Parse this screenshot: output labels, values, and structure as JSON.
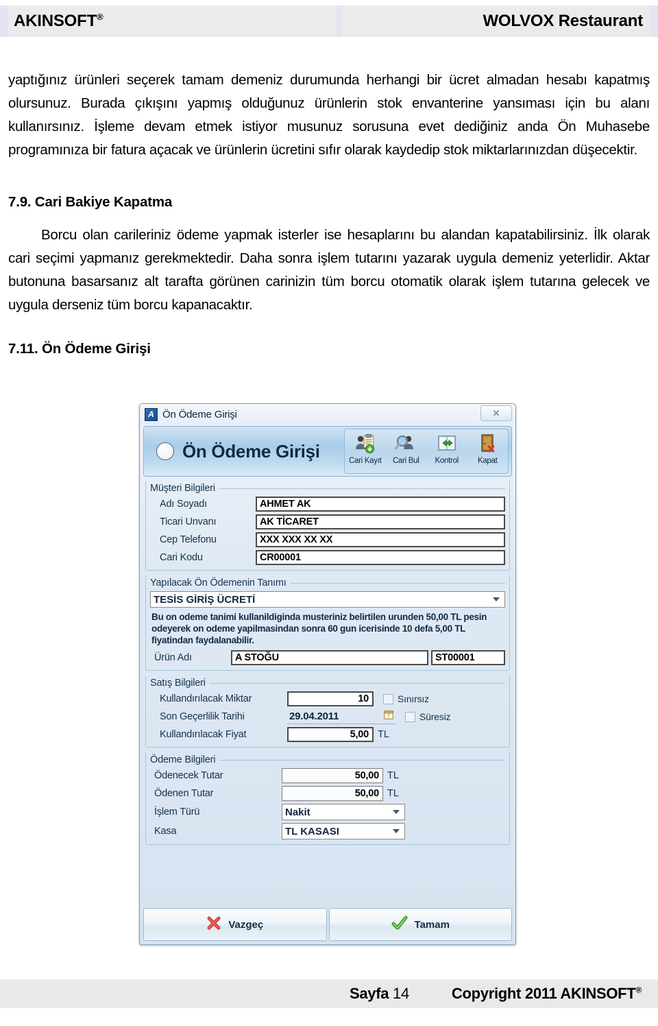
{
  "header": {
    "brand": "AKINSOFT",
    "brand_mark": "®",
    "product": "WOLVOX Restaurant"
  },
  "content": {
    "paragraph_1": "yaptığınız ürünleri seçerek tamam demeniz durumunda herhangi bir ücret almadan hesabı kapatmış olursunuz. Burada çıkışını yapmış olduğunuz ürünlerin stok envanterine yansıması için bu alanı kullanırsınız. İşleme devam etmek istiyor musunuz sorusuna evet dediğiniz anda Ön Muhasebe programınıza bir fatura açacak ve ürünlerin ücretini sıfır olarak kaydedip stok miktarlarınızdan düşecektir.",
    "section_79_title": "7.9. Cari Bakiye Kapatma",
    "paragraph_2": "Borcu olan carileriniz ödeme yapmak isterler ise hesaplarını bu alandan kapatabilirsiniz. İlk olarak cari seçimi yapmanız gerekmektedir. Daha sonra işlem tutarını yazarak uygula demeniz yeterlidir. Aktar butonuna basarsanız alt tarafta görünen carinizin tüm borcu otomatik olarak işlem tutarına gelecek ve uygula derseniz tüm borcu kapanacaktır.",
    "section_711_title": "7.11. Ön Ödeme Girişi"
  },
  "dialog": {
    "window_title": "Ön Ödeme Girişi",
    "app_icon_letter": "A",
    "close_label": "✕",
    "banner_title": "Ön Ödeme Girişi",
    "toolbar": [
      {
        "label": "Cari Kayıt",
        "icon": "user-record-add-icon"
      },
      {
        "label": "Cari Bul",
        "icon": "user-search-icon"
      },
      {
        "label": "Kontrol",
        "icon": "sync-arrows-icon"
      },
      {
        "label": "Kapat",
        "icon": "door-close-icon"
      }
    ],
    "customer_group": {
      "legend": "Müşteri Bilgileri",
      "fields": [
        {
          "label": "Adı Soyadı",
          "value": "AHMET AK"
        },
        {
          "label": "Ticari Unvanı",
          "value": "AK TİCARET"
        },
        {
          "label": "Cep Telefonu",
          "value": "XXX XXX XX XX"
        },
        {
          "label": "Cari Kodu",
          "value": "CR00001"
        }
      ]
    },
    "definition_group": {
      "legend": "Yapılacak Ön Ödemenin Tanımı",
      "combo_value": "TESİS GİRİŞ ÜCRETİ",
      "description": "Bu on odeme tanimi kullanildiginda musteriniz belirtilen urunden 50,00 TL pesin odeyerek on odeme yapilmasindan sonra 60 gun icerisinde 10 defa 5,00 TL fiyatindan faydalanabilir.",
      "product_label": "Ürün Adı",
      "product_name": "A STOĞU",
      "product_code": "ST00001"
    },
    "sales_group": {
      "legend": "Satış Bilgileri",
      "quantity_label": "Kullandırılacak Miktar",
      "quantity_value": "10",
      "unlimited_qty_label": "Sınırsız",
      "date_label": "Son Geçerlilik Tarihi",
      "date_value": "29.04.2011",
      "unlimited_time_label": "Süresiz",
      "price_label": "Kullandırılacak Fiyat",
      "price_value": "5,00",
      "price_unit": "TL"
    },
    "payment_group": {
      "legend": "Ödeme Bilgileri",
      "payable_label": "Ödenecek Tutar",
      "payable_value": "50,00",
      "payable_unit": "TL",
      "paid_label": "Ödenen Tutar",
      "paid_value": "50,00",
      "paid_unit": "TL",
      "type_label": "İşlem Türü",
      "type_value": "Nakit",
      "cash_label": "Kasa",
      "cash_value": "TL KASASI"
    },
    "footer": {
      "cancel_label": "Vazgeç",
      "ok_label": "Tamam"
    }
  },
  "page_footer": {
    "page_word": "Sayfa",
    "page_number": "14",
    "copyright": "Copyright 2011 AKINSOFT",
    "copyright_mark": "®"
  }
}
